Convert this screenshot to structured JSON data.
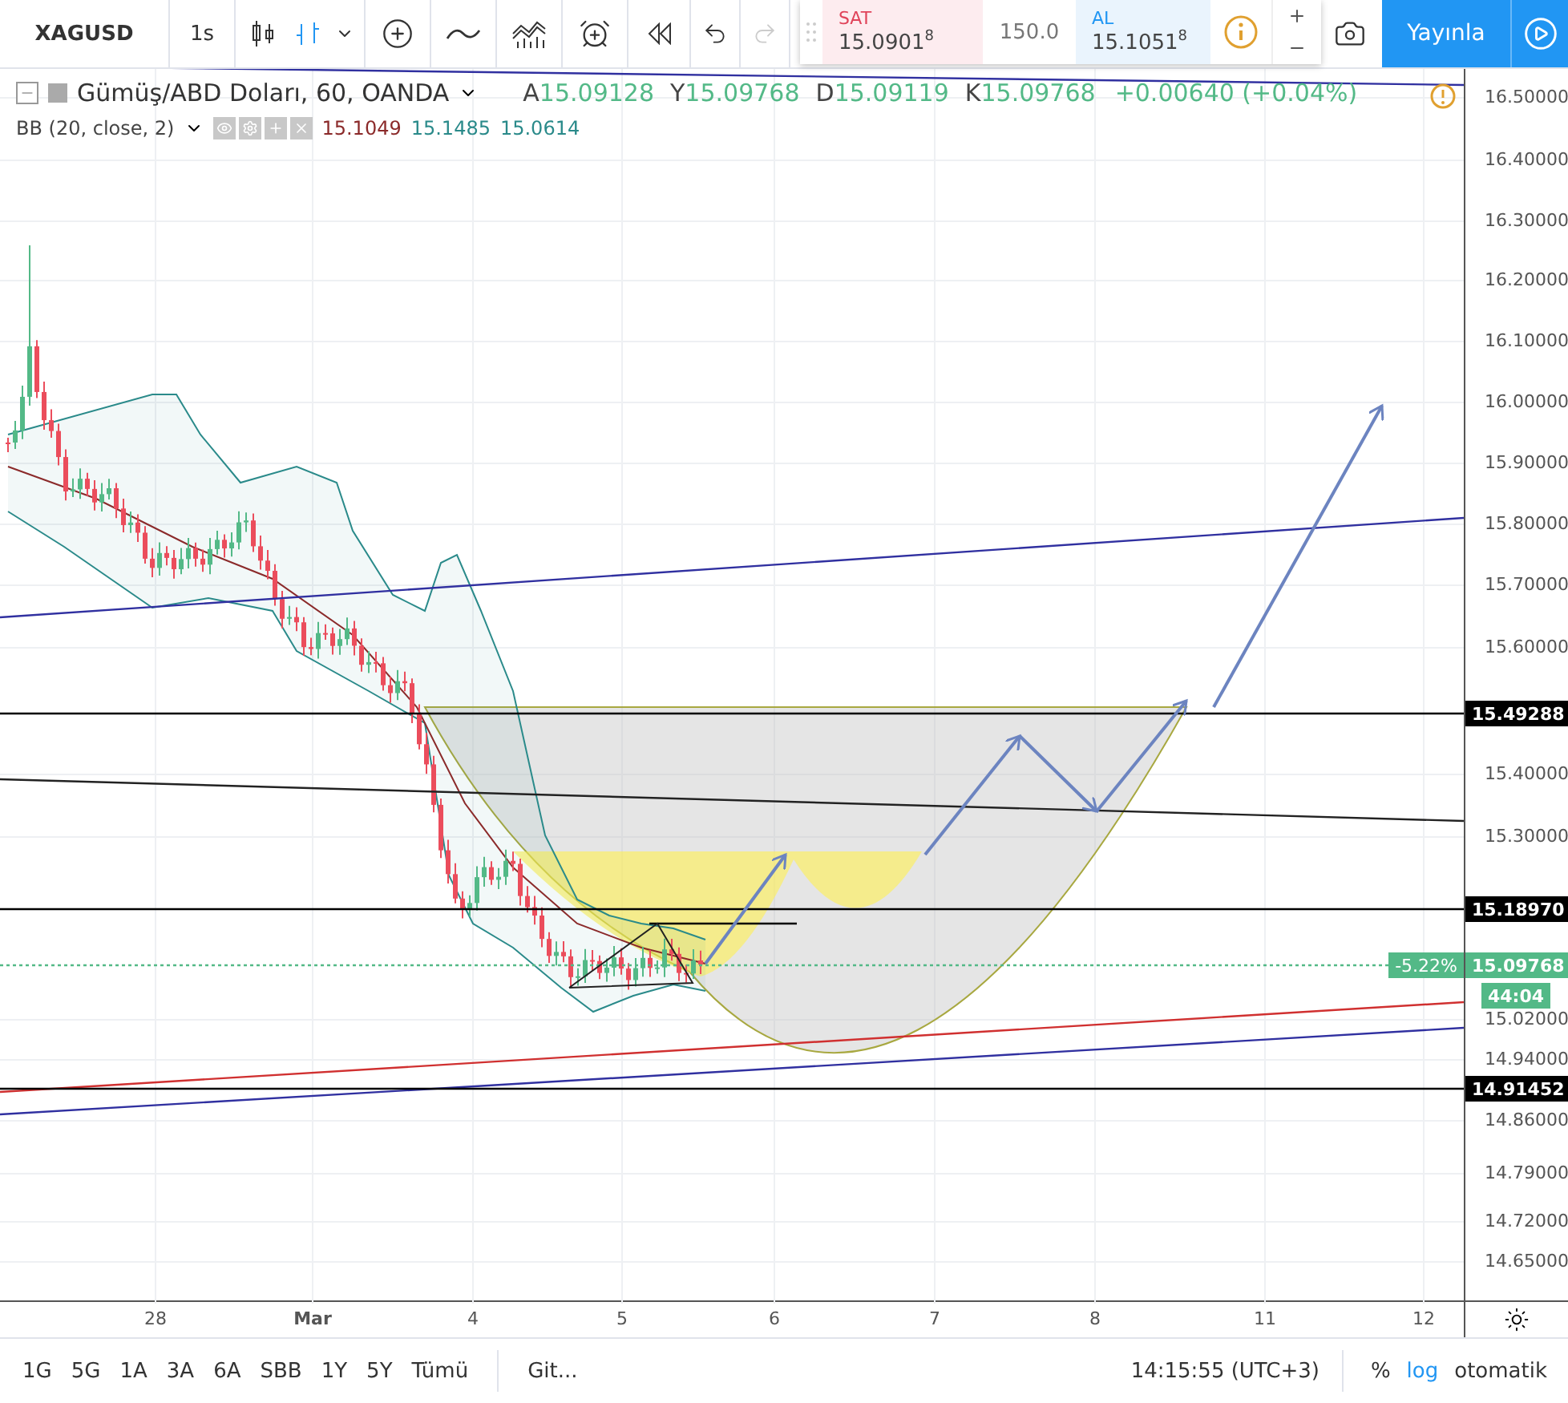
{
  "toolbar": {
    "symbol": "XAGUSD",
    "interval": "1s"
  },
  "trade": {
    "sell": {
      "label": "SAT",
      "price": "15.0901",
      "sup": "8"
    },
    "quantity": "150.0",
    "buy": {
      "label": "AL",
      "price": "15.1051",
      "sup": "8"
    },
    "publish": "Yayınla"
  },
  "legend": {
    "title": "Gümüş/ABD Doları, 60, OANDA",
    "ohlc": [
      {
        "key": "A",
        "value": "15.09128"
      },
      {
        "key": "Y",
        "value": "15.09768"
      },
      {
        "key": "D",
        "value": "15.09119"
      },
      {
        "key": "K",
        "value": "15.09768"
      }
    ],
    "change": "+0.00640 (+0.04%)"
  },
  "indicator": {
    "name": "BB (20, close, 2)",
    "values": [
      {
        "value": "15.1049",
        "color": "#8b2a2a"
      },
      {
        "value": "15.1485",
        "color": "#2a8a8a"
      },
      {
        "value": "15.0614",
        "color": "#2a8a8a"
      }
    ]
  },
  "price_axis": {
    "ticks": [
      "16.50000",
      "16.40000",
      "16.30000",
      "16.20000",
      "16.10000",
      "16.00000",
      "15.90000",
      "15.80000",
      "15.70000",
      "15.60000",
      "15.40000",
      "15.30000",
      "15.02000",
      "14.94000",
      "14.86000",
      "14.79000",
      "14.72000",
      "14.65000"
    ],
    "markers": [
      {
        "kind": "level",
        "text": "15.49288"
      },
      {
        "kind": "level",
        "text": "15.18970"
      },
      {
        "kind": "last",
        "text": "15.09768",
        "change": "-5.22%"
      },
      {
        "kind": "timer",
        "text": "44:04"
      },
      {
        "kind": "level",
        "text": "14.91452"
      }
    ]
  },
  "time_axis": {
    "labels": [
      {
        "text": "28",
        "kind": "day"
      },
      {
        "text": "Mar",
        "kind": "month"
      },
      {
        "text": "4",
        "kind": "day"
      },
      {
        "text": "5",
        "kind": "day"
      },
      {
        "text": "6",
        "kind": "day"
      },
      {
        "text": "7",
        "kind": "day"
      },
      {
        "text": "8",
        "kind": "day"
      },
      {
        "text": "11",
        "kind": "day"
      },
      {
        "text": "12",
        "kind": "day"
      }
    ]
  },
  "bottom_bar": {
    "ranges": [
      "1G",
      "5G",
      "1A",
      "3A",
      "6A",
      "SBB",
      "1Y",
      "5Y",
      "Tümü"
    ],
    "goto": "Git...",
    "clock": "14:15:55 (UTC+3)",
    "scale_modes": [
      {
        "label": "%",
        "selected": false
      },
      {
        "label": "log",
        "selected": true
      },
      {
        "label": "otomatik",
        "selected": false
      }
    ]
  }
}
